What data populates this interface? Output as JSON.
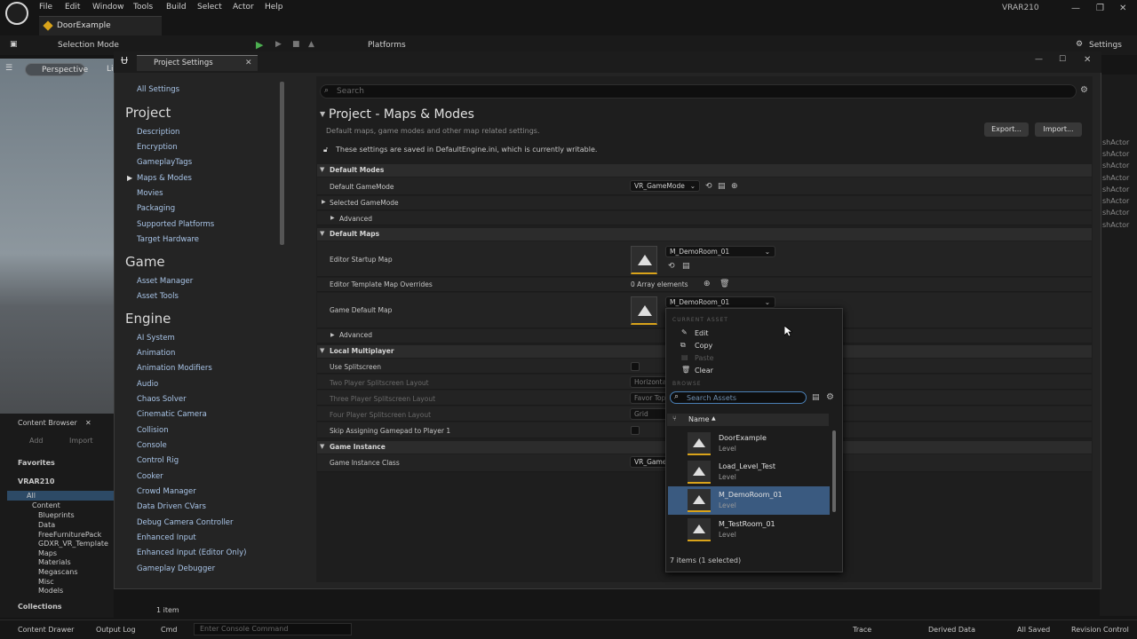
{
  "menubar": {
    "items": [
      "File",
      "Edit",
      "Window",
      "Tools",
      "Build",
      "Select",
      "Actor",
      "Help"
    ],
    "project_name": "VRAR210"
  },
  "doc_tab": {
    "label": "DoorExample"
  },
  "toolbar": {
    "selection_mode": "Selection Mode",
    "platforms": "Platforms",
    "settings": "Settings"
  },
  "viewport": {
    "perspective": "Perspective",
    "lit": "Li"
  },
  "content_browser": {
    "tab": "Content Browser",
    "add": "Add",
    "import": "Import",
    "favorites": "Favorites",
    "project": "VRAR210",
    "tree": [
      "All",
      "Content",
      "Blueprints",
      "Data",
      "FreeFurniturePack",
      "GDXR_VR_Template",
      "Maps",
      "Materials",
      "Megascans",
      "Misc",
      "Models"
    ],
    "collections": "Collections",
    "item_count": "1 item"
  },
  "right_panel": {
    "items": [
      "shActor",
      "shActor",
      "shActor",
      "shActor",
      "shActor",
      "shActor",
      "shActor",
      "shActor",
      "shActor",
      "shActor",
      "shActor",
      "shActor"
    ]
  },
  "statusbar": {
    "content_drawer": "Content Drawer",
    "output_log": "Output Log",
    "cmd": "Cmd",
    "console_placeholder": "Enter Console Command",
    "trace": "Trace",
    "derived_data": "Derived Data",
    "all_saved": "All Saved",
    "revision_control": "Revision Control"
  },
  "project_settings": {
    "title": "Project Settings",
    "sidebar": {
      "all_settings": "All Settings",
      "project_heading": "Project",
      "project_items": [
        "Description",
        "Encryption",
        "GameplayTags",
        "Maps & Modes",
        "Movies",
        "Packaging",
        "Supported Platforms",
        "Target Hardware"
      ],
      "game_heading": "Game",
      "game_items": [
        "Asset Manager",
        "Asset Tools"
      ],
      "engine_heading": "Engine",
      "engine_items": [
        "AI System",
        "Animation",
        "Animation Modifiers",
        "Audio",
        "Chaos Solver",
        "Cinematic Camera",
        "Collision",
        "Console",
        "Control Rig",
        "Cooker",
        "Crowd Manager",
        "Data Driven CVars",
        "Debug Camera Controller",
        "Enhanced Input",
        "Enhanced Input (Editor Only)",
        "Gameplay Debugger"
      ]
    },
    "search_placeholder": "Search",
    "section_title": "Project - Maps & Modes",
    "section_desc": "Default maps, game modes and other map related settings.",
    "notice": "These settings are saved in DefaultEngine.ini, which is currently writable.",
    "export_label": "Export...",
    "import_label": "Import...",
    "categories": {
      "default_modes": "Default Modes",
      "default_maps": "Default Maps",
      "local_multiplayer": "Local Multiplayer",
      "game_instance": "Game Instance"
    },
    "rows": {
      "default_gamemode": "Default GameMode",
      "default_gamemode_value": "VR_GameMode",
      "selected_gamemode": "Selected GameMode",
      "advanced": "Advanced",
      "editor_startup_map": "Editor Startup Map",
      "editor_startup_map_value": "M_DemoRoom_01",
      "editor_template_map_overrides": "Editor Template Map Overrides",
      "array_elements": "0 Array elements",
      "game_default_map": "Game Default Map",
      "game_default_map_value": "M_DemoRoom_01",
      "use_splitscreen": "Use Splitscreen",
      "two_player_layout": "Two Player Splitscreen Layout",
      "two_player_value": "Horizontal",
      "three_player_layout": "Three Player Splitscreen Layout",
      "three_player_value": "Favor Top",
      "four_player_layout": "Four Player Splitscreen Layout",
      "four_player_value": "Grid",
      "skip_gamepad": "Skip Assigning Gamepad to Player 1",
      "game_instance_class": "Game Instance Class",
      "game_instance_value": "VR_GameI"
    }
  },
  "asset_popup": {
    "current_asset_heading": "CURRENT ASSET",
    "edit": "Edit",
    "copy": "Copy",
    "paste": "Paste",
    "clear": "Clear",
    "browse_heading": "BROWSE",
    "search_placeholder": "Search Assets",
    "name_column": "Name",
    "assets": [
      {
        "name": "DoorExample",
        "type": "Level"
      },
      {
        "name": "Load_Level_Test",
        "type": "Level"
      },
      {
        "name": "M_DemoRoom_01",
        "type": "Level"
      },
      {
        "name": "M_TestRoom_01",
        "type": "Level"
      }
    ],
    "footer": "7 items (1 selected)"
  }
}
